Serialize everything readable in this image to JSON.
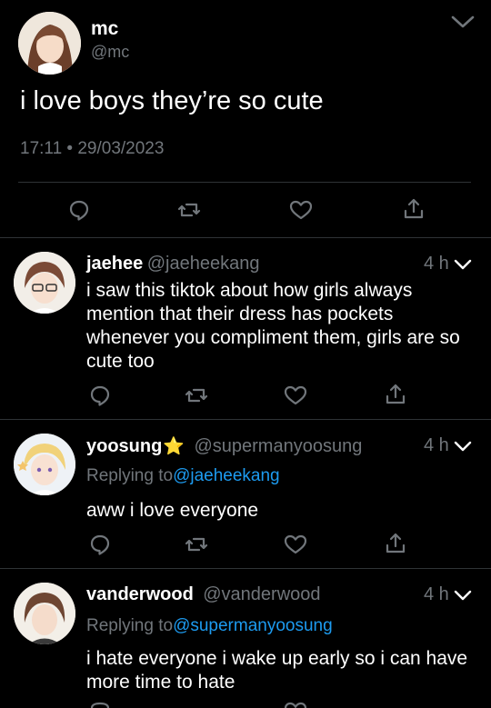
{
  "main_tweet": {
    "name": "mc",
    "handle": "@mc",
    "text": "i love boys they’re so cute",
    "timestamp": "17:11 • 29/03/2023"
  },
  "replies": [
    {
      "name": "jaehee",
      "handle": "@jaeheekang",
      "time": "4 h",
      "text": "i saw this tiktok about how girls always mention that their dress has pockets whenever you compliment them, girls are so cute too"
    },
    {
      "name": "yoosung",
      "name_emoji": "⭐",
      "handle": "@supermanyoosung",
      "time": "4 h",
      "replying_to_label": "Replying to",
      "replying_to_handle": "@jaeheekang",
      "text": "aww i love everyone"
    },
    {
      "name": "vanderwood",
      "handle": "@vanderwood",
      "time": "4 h",
      "replying_to_label": "Replying to",
      "replying_to_handle": "@supermanyoosung",
      "text": "i hate everyone i wake up early so i can have more time to hate"
    }
  ],
  "colors": {
    "background": "#000000",
    "text": "#ffffff",
    "secondary": "#71767b",
    "link": "#1d9bf0",
    "divider": "#2f3336"
  },
  "icons": [
    "reply-icon",
    "retweet-icon",
    "like-icon",
    "share-icon",
    "chevron-down-icon"
  ]
}
